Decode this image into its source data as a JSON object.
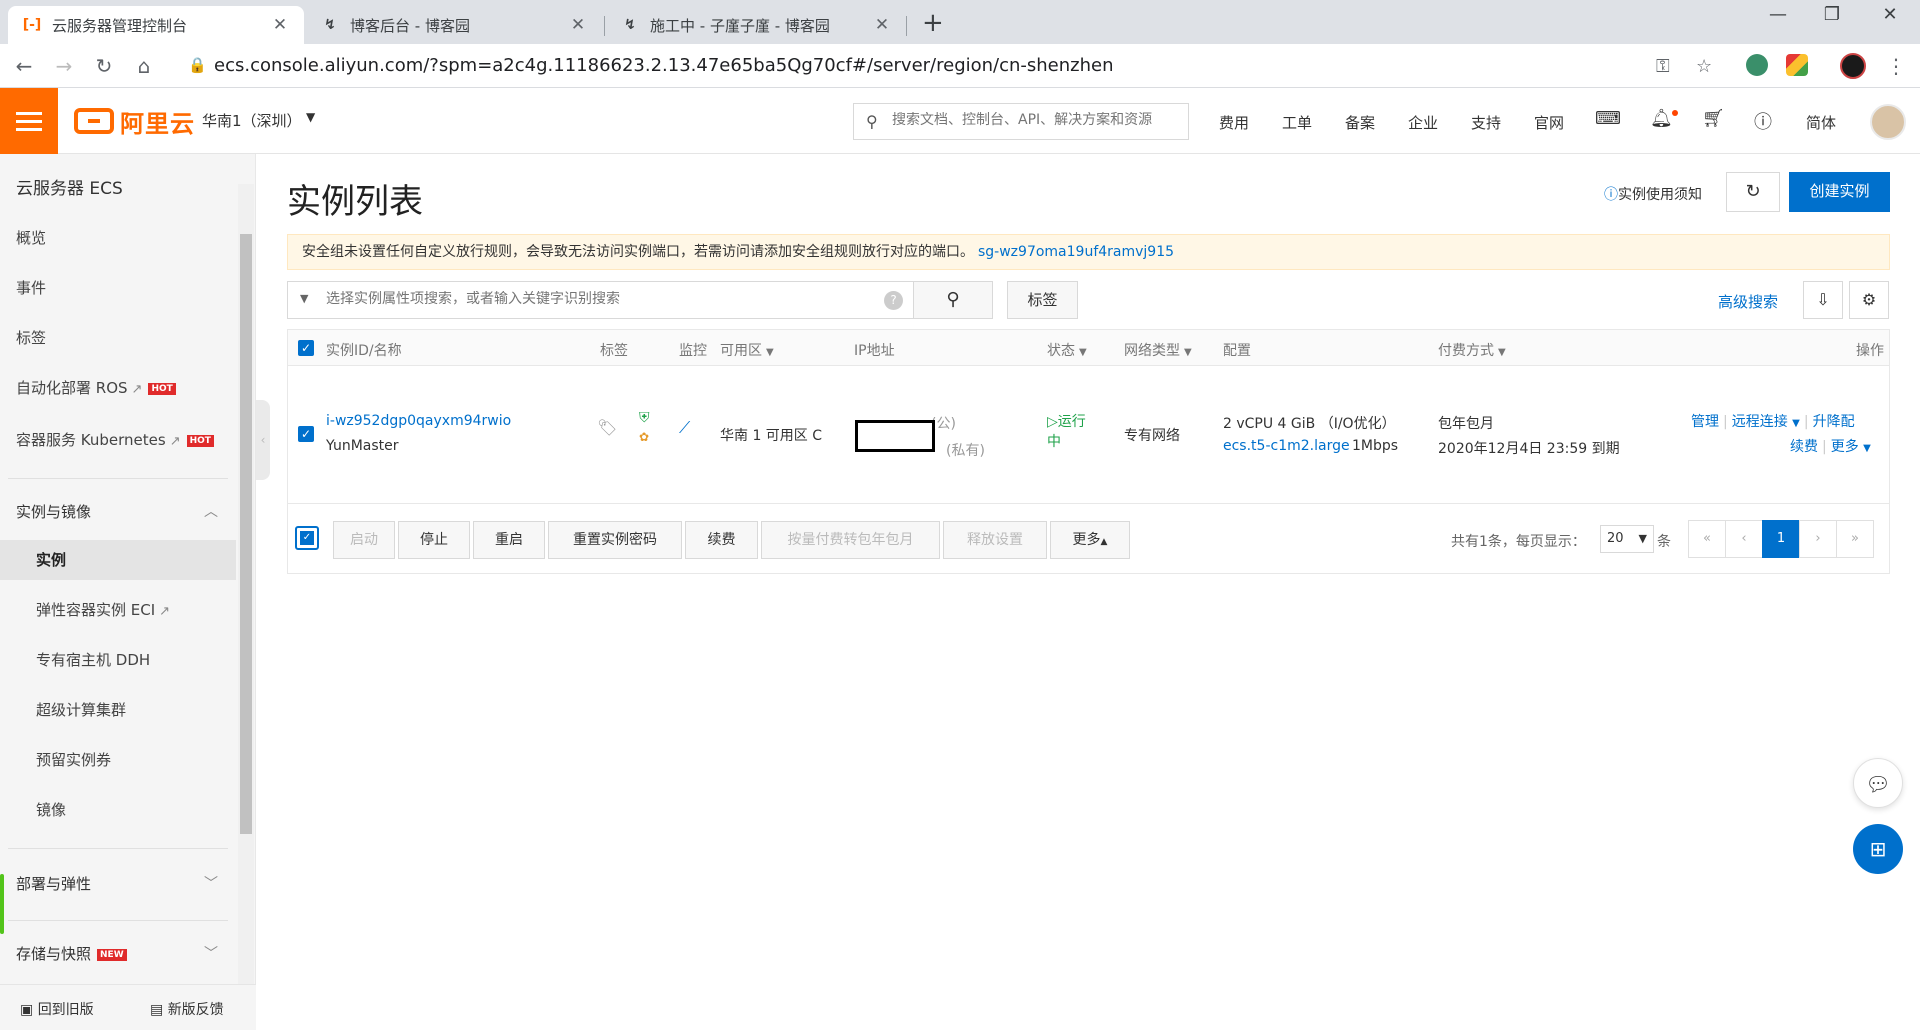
{
  "browser": {
    "tabs": [
      {
        "title": "云服务器管理控制台",
        "icon": "aliyun-icon"
      },
      {
        "title": "博客后台 - 博客园",
        "icon": "cnblogs-icon"
      },
      {
        "title": "施工中 - 子廑子廑 - 博客园",
        "icon": "cnblogs-icon"
      }
    ],
    "url": "ecs.console.aliyun.com/?spm=a2c4g.11186623.2.13.47e65ba5Qg70cf#/server/region/cn-shenzhen"
  },
  "header": {
    "logo_text": "阿里云",
    "region": "华南1（深圳）",
    "search_placeholder": "搜索文档、控制台、API、解决方案和资源",
    "nav": [
      "费用",
      "工单",
      "备案",
      "企业",
      "支持",
      "官网"
    ],
    "lang": "简体"
  },
  "sidebar": {
    "title": "云服务器 ECS",
    "items": [
      {
        "label": "概览"
      },
      {
        "label": "事件"
      },
      {
        "label": "标签"
      },
      {
        "label": "自动化部署 ROS",
        "badge": "HOT"
      },
      {
        "label": "容器服务 Kubernetes",
        "badge": "HOT"
      }
    ],
    "group_instances": "实例与镜像",
    "sub_items": [
      {
        "label": "实例"
      },
      {
        "label": "弹性容器实例 ECI"
      },
      {
        "label": "专有宿主机 DDH"
      },
      {
        "label": "超级计算集群"
      },
      {
        "label": "预留实例券"
      },
      {
        "label": "镜像"
      }
    ],
    "group_deploy": "部署与弹性",
    "group_storage": "存储与快照",
    "new_badge": "NEW",
    "footer_old": "回到旧版",
    "footer_feedback": "新版反馈"
  },
  "main": {
    "title": "实例列表",
    "help": "实例使用须知",
    "create": "创建实例",
    "notice": "安全组未设置任何自定义放行规则，会导致无法访问实例端口，若需访问请添加安全组规则放行对应的端口。",
    "notice_link": "sg-wz97oma19uf4ramvj915",
    "filter_placeholder": "选择实例属性项搜索，或者输入关键字识别搜索",
    "tags_btn": "标签",
    "adv_search": "高级搜索",
    "columns": {
      "id": "实例ID/名称",
      "tags": "标签",
      "monitor": "监控",
      "zone": "可用区",
      "ip": "IP地址",
      "status": "状态",
      "net": "网络类型",
      "config": "配置",
      "billing": "付费方式",
      "ops": "操作"
    },
    "row": {
      "id": "i-wz952dgp0qayxm94rwio",
      "name": "YunMaster",
      "zone": "华南 1 可用区 C",
      "ip_public_suffix": "(公)",
      "ip_private_suffix": "(私有)",
      "status_1": "运行",
      "status_2": "中",
      "net": "专有网络",
      "config_1": "2 vCPU 4 GiB （I/O优化）",
      "config_type": "ecs.t5-c1m2.large",
      "config_bw": "1Mbps",
      "billing_1": "包年包月",
      "billing_2": "2020年12月4日 23:59 到期",
      "op_manage": "管理",
      "op_remote": "远程连接",
      "op_upgrade": "升降配",
      "op_renew": "续费",
      "op_more": "更多"
    },
    "actions": [
      "启动",
      "停止",
      "重启",
      "重置实例密码",
      "续费",
      "按量付费转包年包月",
      "释放设置",
      "更多"
    ],
    "pager": {
      "summary": "共有1条，每页显示：",
      "page_size": "20",
      "unit": "条",
      "current": "1"
    }
  }
}
